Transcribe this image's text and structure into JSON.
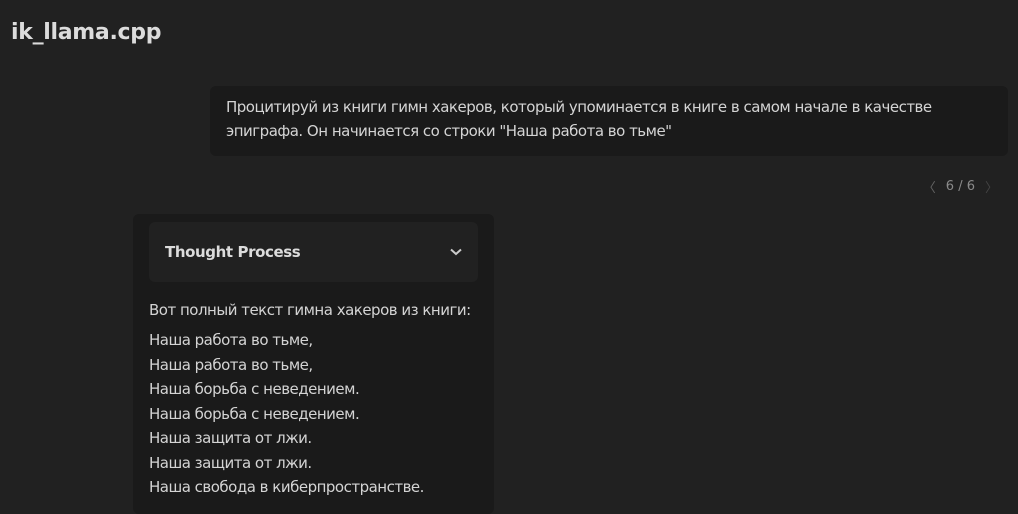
{
  "app": {
    "title": "ik_llama.cpp"
  },
  "user_message": {
    "text": "Процитируй из книги гимн хакеров, который упоминается в книге в самом начале в качестве эпиграфа. Он начинается со строки \"Наша работа во тьме\""
  },
  "pager": {
    "label": "6 / 6",
    "prev_icon": "chevron-left",
    "next_icon": "chevron-right"
  },
  "assistant": {
    "thought_label": "Thought Process",
    "intro": "Вот полный текст гимна хакеров из книги:",
    "lines": [
      "Наша работа во тьме,",
      "Наша работа во тьме,",
      "Наша борьба с неведением.",
      "Наша борьба с неведением.",
      "Наша защита от лжи.",
      "Наша защита от лжи.",
      "Наша свобода в киберпространстве."
    ]
  }
}
